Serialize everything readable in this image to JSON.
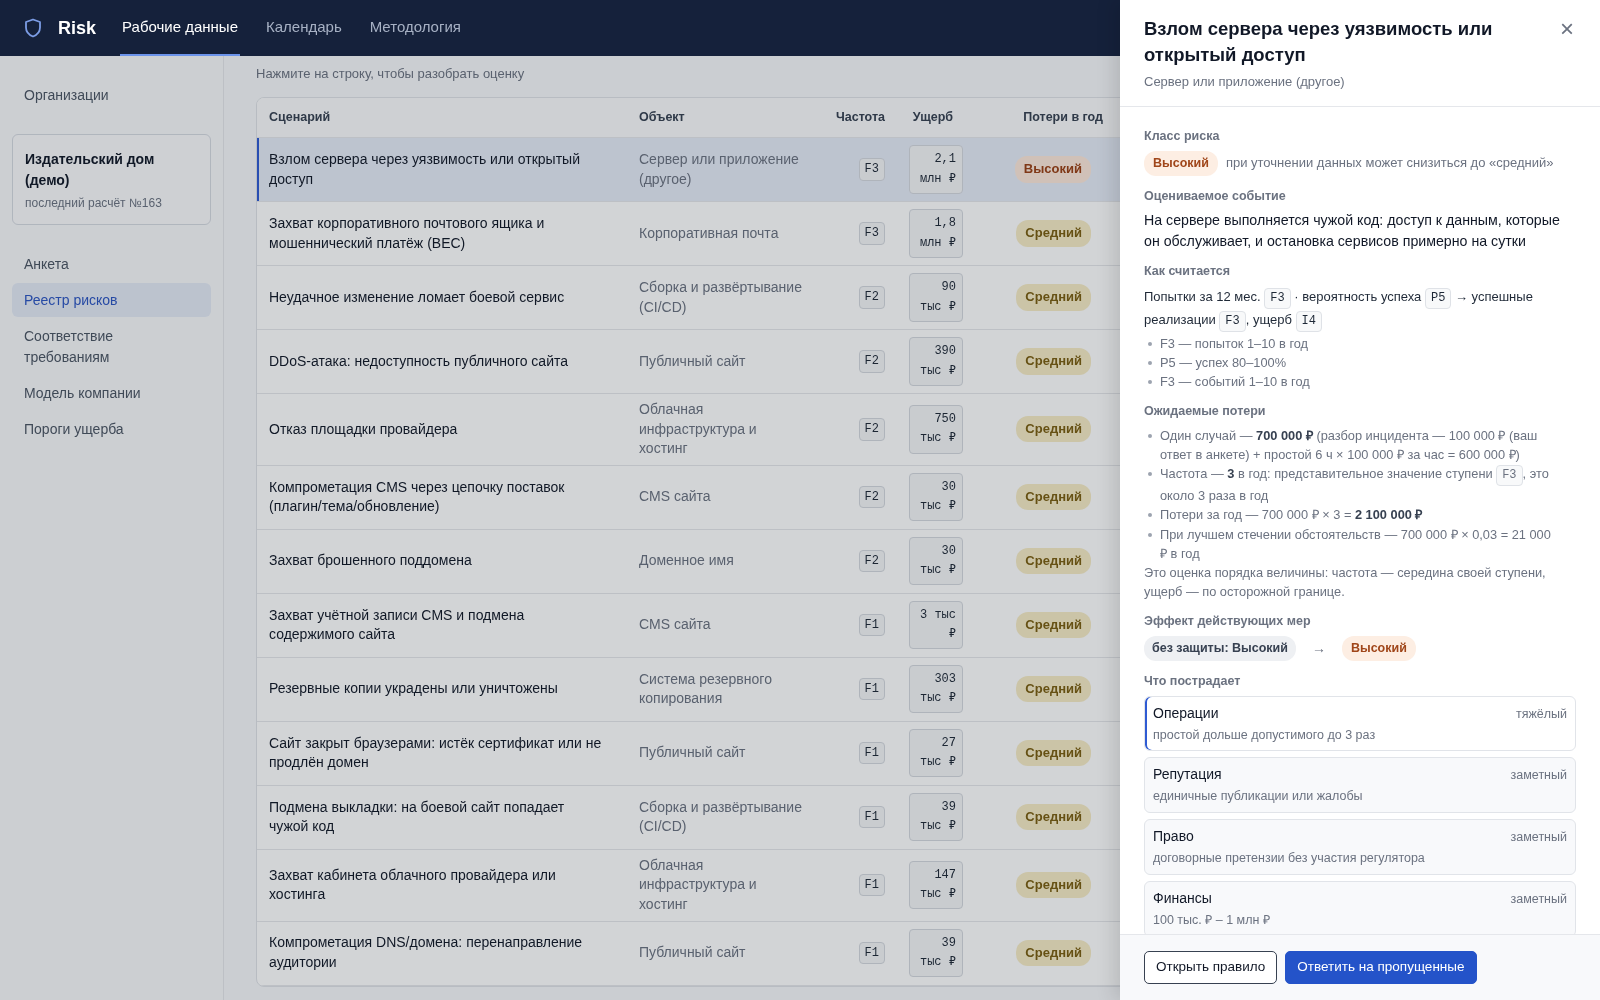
{
  "navbar": {
    "brand": "Risk",
    "tabs": [
      {
        "label": "Рабочие данные",
        "selected": true
      },
      {
        "label": "Календарь",
        "selected": false
      },
      {
        "label": "Методология",
        "selected": false
      }
    ]
  },
  "sidebar": {
    "items": [
      {
        "kind": "link",
        "label": "Организации",
        "selected": false
      },
      {
        "kind": "org",
        "title": "Издательский дом (демо)",
        "subtitle": "последний расчёт №163"
      },
      {
        "kind": "link",
        "label": "Анкета",
        "selected": false
      },
      {
        "kind": "link",
        "label": "Реестр рисков",
        "selected": true
      },
      {
        "kind": "link",
        "label": "Соответствие требованиям",
        "selected": false
      },
      {
        "kind": "link",
        "label": "Модель компании",
        "selected": false
      },
      {
        "kind": "link",
        "label": "Пороги ущерба",
        "selected": false
      }
    ]
  },
  "main": {
    "hint": "Нажмите на строку, чтобы разобрать оценку",
    "table": {
      "columns": [
        "Сценарий",
        "Объект",
        "Частота",
        "Ущерб",
        "Потери в год"
      ],
      "rows": [
        {
          "scenario": "Взлом сервера через уязвимость или открытый доступ",
          "object": "Сервер или приложение (другое)",
          "frequency": "F3",
          "damage": "2,1 млн ₽",
          "loss": {
            "label": "Высокий",
            "severe": true
          },
          "selected": true
        },
        {
          "scenario": "Захват корпоративного почтового ящика и мошеннический платёж (BEC)",
          "object": "Корпоративная почта",
          "frequency": "F3",
          "damage": "1,8 млн ₽",
          "loss": {
            "label": "Средний",
            "severe": false
          },
          "selected": false
        },
        {
          "scenario": "Неудачное изменение ломает боевой сервис",
          "object": "Сборка и развёртывание (CI/CD)",
          "frequency": "F2",
          "damage": "90 тыс ₽",
          "loss": {
            "label": "Средний",
            "severe": false
          },
          "selected": false
        },
        {
          "scenario": "DDoS-атака: недоступность публичного сайта",
          "object": "Публичный сайт",
          "frequency": "F2",
          "damage": "390 тыс ₽",
          "loss": {
            "label": "Средний",
            "severe": false
          },
          "selected": false
        },
        {
          "scenario": "Отказ площадки провайдера",
          "object": "Облачная инфраструктура и хостинг",
          "frequency": "F2",
          "damage": "750 тыс ₽",
          "loss": {
            "label": "Средний",
            "severe": false
          },
          "selected": false
        },
        {
          "scenario": "Компрометация CMS через цепочку поставок (плагин/тема/обновление)",
          "object": "CMS сайта",
          "frequency": "F2",
          "damage": "30 тыс ₽",
          "loss": {
            "label": "Средний",
            "severe": false
          },
          "selected": false
        },
        {
          "scenario": "Захват брошенного поддомена",
          "object": "Доменное имя",
          "frequency": "F2",
          "damage": "30 тыс ₽",
          "loss": {
            "label": "Средний",
            "severe": false
          },
          "selected": false
        },
        {
          "scenario": "Захват учётной записи CMS и подмена содержимого сайта",
          "object": "CMS сайта",
          "frequency": "F1",
          "damage": "3 тыс ₽",
          "loss": {
            "label": "Средний",
            "severe": false
          },
          "selected": false
        },
        {
          "scenario": "Резервные копии украдены или уничтожены",
          "object": "Система резервного копирования",
          "frequency": "F1",
          "damage": "303 тыс ₽",
          "loss": {
            "label": "Средний",
            "severe": false
          },
          "selected": false
        },
        {
          "scenario": "Сайт закрыт браузерами: истёк сертификат или не продлён домен",
          "object": "Публичный сайт",
          "frequency": "F1",
          "damage": "27 тыс ₽",
          "loss": {
            "label": "Средний",
            "severe": false
          },
          "selected": false
        },
        {
          "scenario": "Подмена выкладки: на боевой сайт попадает чужой код",
          "object": "Сборка и развёртывание (CI/CD)",
          "frequency": "F1",
          "damage": "39 тыс ₽",
          "loss": {
            "label": "Средний",
            "severe": false
          },
          "selected": false
        },
        {
          "scenario": "Захват кабинета облачного провайдера или хостинга",
          "object": "Облачная инфраструктура и хостинг",
          "frequency": "F1",
          "damage": "147 тыс ₽",
          "loss": {
            "label": "Средний",
            "severe": false
          },
          "selected": false
        },
        {
          "scenario": "Компрометация DNS/домена: перенаправление аудитории",
          "object": "Публичный сайт",
          "frequency": "F1",
          "damage": "39 тыс ₽",
          "loss": {
            "label": "Средний",
            "severe": false
          },
          "selected": false
        }
      ]
    }
  },
  "drawer": {
    "title": "Взлом сервера через уязвимость или открытый доступ",
    "subtitle": "Сервер или приложение (другое)",
    "close": "×",
    "risk_class": {
      "label": "Класс риска",
      "badge": {
        "label": "Высокий",
        "severe": true
      },
      "note": "при уточнении данных может снизиться до «средний»"
    },
    "event": {
      "label": "Оцениваемое событие",
      "text": "На сервере выполняется чужой код: доступ к данным, которые он обслуживает, и остановка сервисов примерно на сутки"
    },
    "calculation": {
      "label": "Как считается",
      "formula": [
        {
          "kind": "text",
          "text": "Попытки за 12 мес. "
        },
        {
          "kind": "code",
          "text": "F3"
        },
        {
          "kind": "text",
          "text": " · вероятность успеха "
        },
        {
          "kind": "code",
          "text": "P5"
        },
        {
          "kind": "text",
          "text": " → успешные реализации "
        },
        {
          "kind": "code",
          "text": "F3"
        },
        {
          "kind": "text",
          "text": ", ущерб "
        },
        {
          "kind": "code",
          "text": "I4"
        }
      ],
      "bullets": [
        "F3 — попыток 1–10 в год",
        "P5 — успех 80–100%",
        "F3 — событий 1–10 в год"
      ]
    },
    "losses": {
      "label": "Ожидаемые потери",
      "bullets": [
        [
          {
            "kind": "text",
            "text": "Один случай — **700 000 ₽** (разбор инцидента — 100 000 ₽ (ваш ответ в анкете) + простой 6 ч × 100 000 ₽ за час = 600 000 ₽)"
          }
        ],
        [
          {
            "kind": "text",
            "text": "Частота — **3** в год: представительное значение ступени "
          },
          {
            "kind": "code",
            "text": "F3"
          },
          {
            "kind": "text",
            "text": ", это около 3 раза в год"
          }
        ],
        [
          {
            "kind": "text",
            "text": "Потери за год — 700 000 ₽ × 3 = **2 100 000 ₽**"
          }
        ],
        [
          {
            "kind": "text",
            "text": "При лучшем стечении обстоятельств — 700 000 ₽ × 0,03 = 21 000 ₽ в год"
          }
        ]
      ],
      "note": "Это оценка порядка величины: частота — середина своей ступени, ущерб — по осторожной границе."
    },
    "effect": {
      "label": "Эффект действующих мер",
      "before": "без защиты: Высокий",
      "arrow": "→",
      "after": {
        "label": "Высокий",
        "severe": true
      }
    },
    "impacts": {
      "label": "Что пострадает",
      "items": [
        {
          "title": "Операции",
          "severity": "тяжёлый",
          "description": "простой дольше допустимого до 3 раз",
          "highlighted": true
        },
        {
          "title": "Репутация",
          "severity": "заметный",
          "description": "единичные публикации или жалобы",
          "highlighted": false
        },
        {
          "title": "Право",
          "severity": "заметный",
          "description": "договорные претензии без участия регулятора",
          "highlighted": false
        },
        {
          "title": "Финансы",
          "severity": "заметный",
          "description": "100 тыс. ₽ – 1 млн ₽",
          "highlighted": false
        }
      ]
    },
    "buttons": [
      {
        "label": "Открыть правило",
        "kind": "outline"
      },
      {
        "label": "Ответить на пропущенные",
        "kind": "primary"
      }
    ]
  }
}
